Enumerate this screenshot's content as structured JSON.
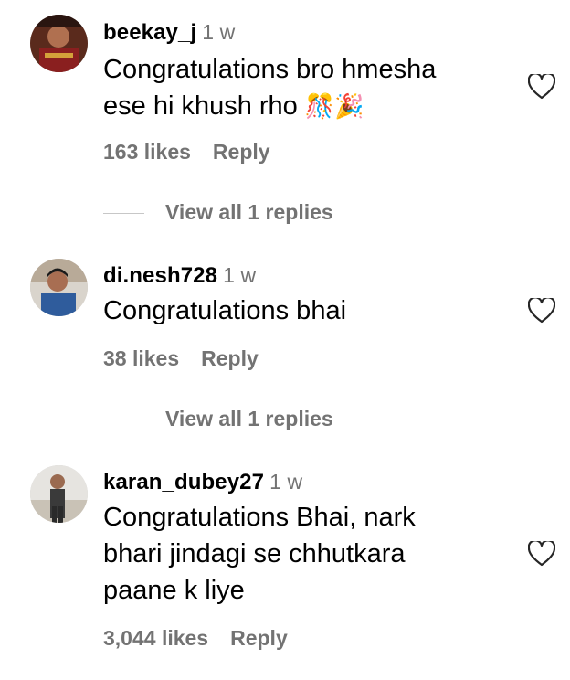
{
  "comments": [
    {
      "username": "beekay_j",
      "time": "1 w",
      "text_line1": "Congratulations bro hmesha",
      "text_line2": "ese hi khush rho",
      "emoji": "🎊🎉",
      "likes": "163 likes",
      "reply": "Reply",
      "view_replies": "View all 1 replies",
      "icons": [
        "avatar",
        "heart-icon"
      ]
    },
    {
      "username": "di.nesh728",
      "time": "1 w",
      "text": "Congratulations bhai",
      "likes": "38 likes",
      "reply": "Reply",
      "view_replies": "View all 1 replies",
      "icons": [
        "avatar",
        "heart-icon"
      ]
    },
    {
      "username": "karan_dubey27",
      "time": "1 w",
      "text_line1": "Congratulations Bhai, nark",
      "text_line2": "bhari jindagi se chhutkara",
      "text_line3": "paane k liye",
      "likes": "3,044 likes",
      "reply": "Reply",
      "icons": [
        "avatar",
        "heart-icon"
      ]
    }
  ],
  "colors": {
    "primary_text": "#000000",
    "secondary_text": "#737373",
    "divider": "#c7c7c7",
    "background": "#ffffff"
  }
}
